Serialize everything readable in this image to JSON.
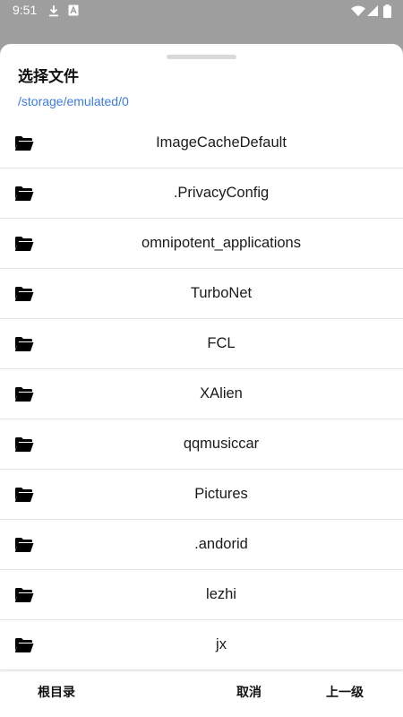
{
  "status_bar": {
    "time": "9:51",
    "icons": [
      "download-icon",
      "a-badge-icon",
      "wifi-icon",
      "signal-icon",
      "battery-icon"
    ]
  },
  "dialog": {
    "title": "选择文件",
    "path": "/storage/emulated/0",
    "items": [
      {
        "name": "ImageCacheDefault",
        "icon": "folder-icon"
      },
      {
        "name": ".PrivacyConfig",
        "icon": "folder-icon"
      },
      {
        "name": "omnipotent_applications",
        "icon": "folder-icon"
      },
      {
        "name": "TurboNet",
        "icon": "folder-icon"
      },
      {
        "name": "FCL",
        "icon": "folder-icon"
      },
      {
        "name": "XAlien",
        "icon": "folder-icon"
      },
      {
        "name": "qqmusiccar",
        "icon": "folder-icon"
      },
      {
        "name": "Pictures",
        "icon": "folder-icon"
      },
      {
        "name": ".andorid",
        "icon": "folder-icon"
      },
      {
        "name": "lezhi",
        "icon": "folder-icon"
      },
      {
        "name": "jx",
        "icon": "folder-icon"
      }
    ],
    "buttons": {
      "root": "根目录",
      "cancel": "取消",
      "up": "上一级"
    }
  },
  "colors": {
    "scrim": "#9e9e9e",
    "path_link": "#3d7be0",
    "sheet": "#ffffff"
  }
}
